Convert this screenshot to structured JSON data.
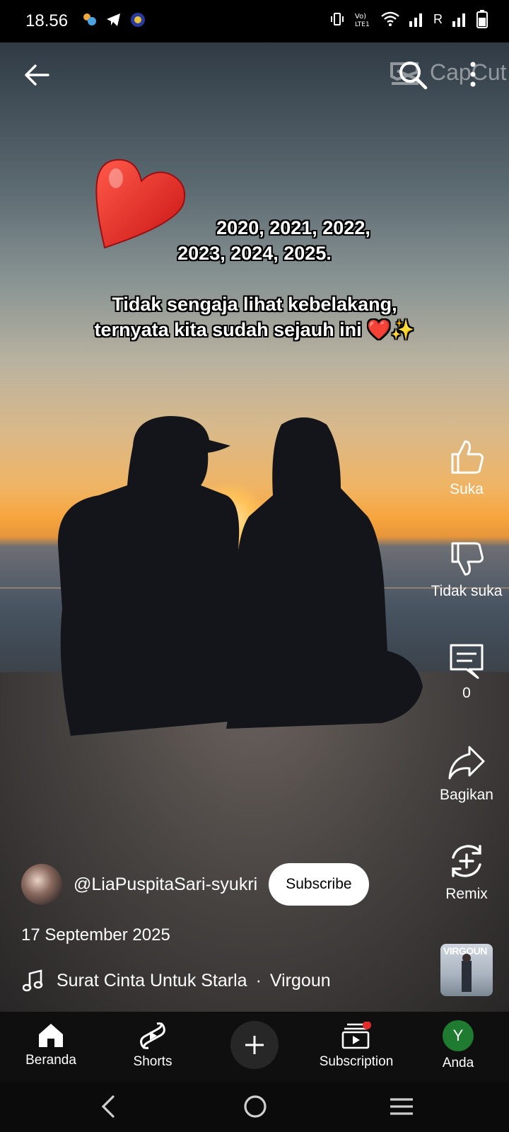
{
  "status_bar": {
    "time": "18.56",
    "carrier_label": "R"
  },
  "video": {
    "watermark": "CapCut",
    "overlay_years": [
      "2020, 2021, 2022,",
      "2023, 2024, 2025."
    ],
    "overlay_caption": [
      "Tidak sengaja lihat kebelakang,",
      "ternyata kita sudah sejauh ini ❤️✨"
    ]
  },
  "actions": {
    "like_label": "Suka",
    "dislike_label": "Tidak suka",
    "comment_count": "0",
    "share_label": "Bagikan",
    "remix_label": "Remix"
  },
  "author": {
    "handle": "@LiaPuspitaSari-syukri",
    "subscribe_label": "Subscribe"
  },
  "post_date": "17 September 2025",
  "music": {
    "title": "Surat Cinta Untuk Starla",
    "separator": "·",
    "artist": "Virgoun",
    "album_label": "VIRGOUN"
  },
  "bottom_nav": {
    "home": "Beranda",
    "shorts": "Shorts",
    "subscriptions": "Subscription",
    "you": "Anda",
    "avatar_letter": "Y"
  },
  "colors": {
    "accent_red": "#e32b2b",
    "avatar_green": "#1e7b2f",
    "nav_bg": "#0f0f0f"
  }
}
